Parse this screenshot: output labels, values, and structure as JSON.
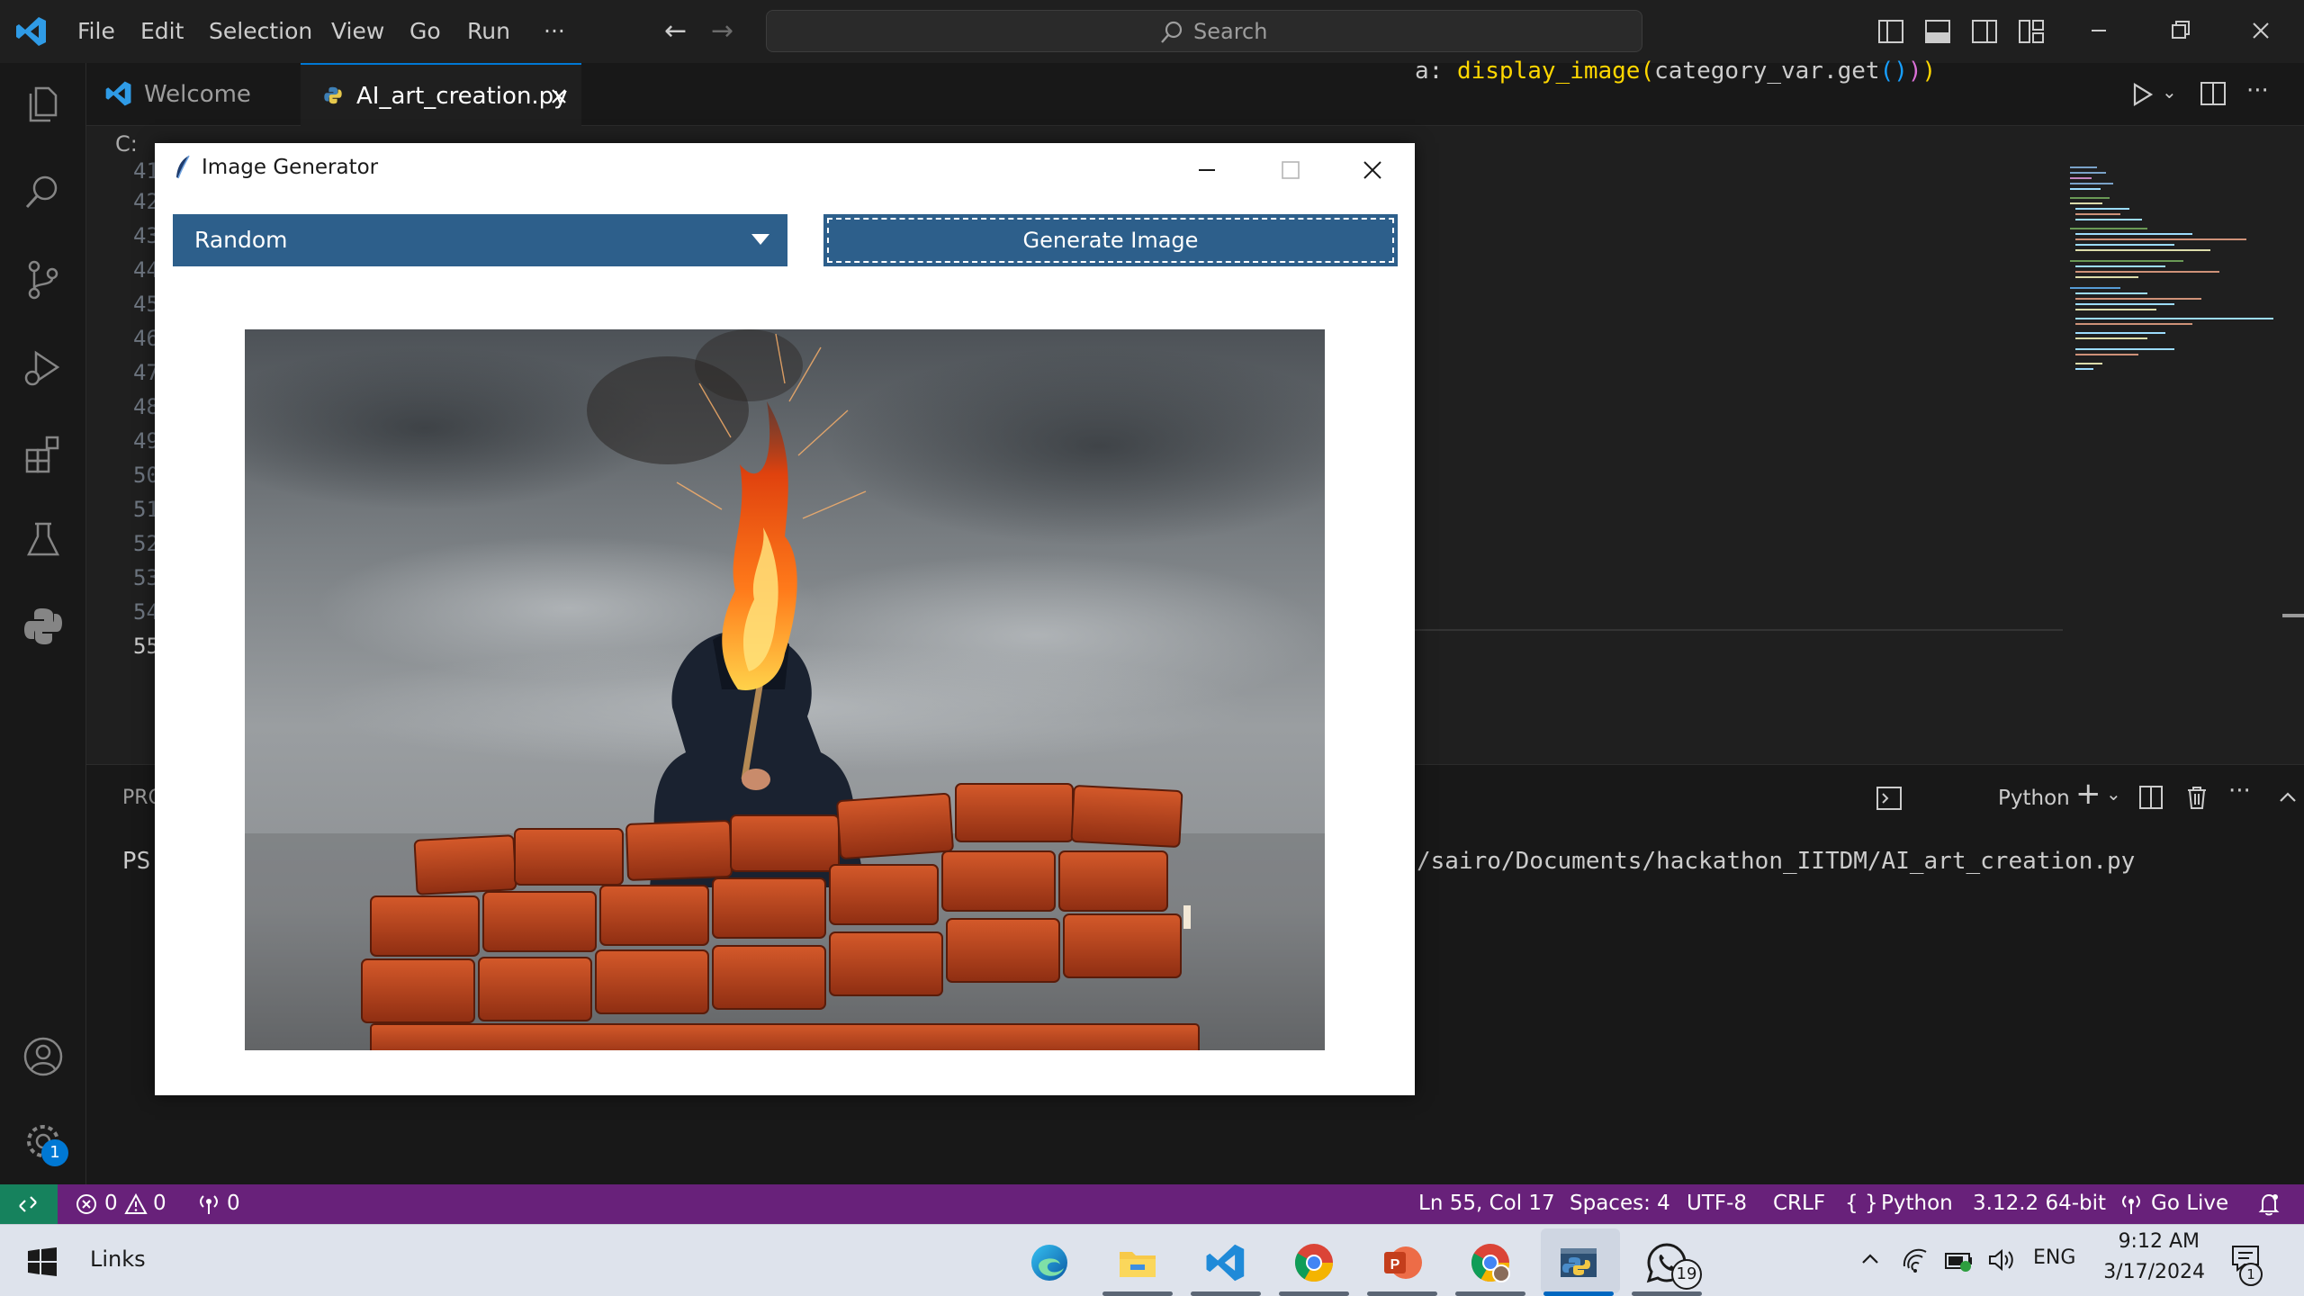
{
  "titlebar": {
    "menus": [
      "File",
      "Edit",
      "Selection",
      "View",
      "Go",
      "Run"
    ],
    "more": "···",
    "search_placeholder": "Search"
  },
  "tabs": {
    "welcome": "Welcome",
    "active_file": "AI_art_creation.py",
    "breadcrumb": "C:"
  },
  "editor": {
    "line_numbers": [
      "41",
      "42",
      "43",
      "44",
      "45",
      "46",
      "47",
      "48",
      "49",
      "50",
      "51",
      "52",
      "53",
      "54",
      "55"
    ],
    "active_line": "55",
    "code_prefix": "a: ",
    "code_call": "display_image",
    "code_arg": "category_var.get",
    "code_parens_inner": "()",
    "code_close_outer": ")",
    "code_close_paren": ")"
  },
  "panel": {
    "tab_label": "PRO",
    "terminal_name": "Python",
    "prompt": "PS",
    "terminal_path": "/sairo/Documents/hackathon_IITDM/AI_art_creation.py"
  },
  "statusbar": {
    "errors": "0",
    "warnings": "0",
    "ports": "0",
    "cursor": "Ln 55, Col 17",
    "spaces": "Spaces: 4",
    "encoding": "UTF-8",
    "eol": "CRLF",
    "language": "Python",
    "interpreter": "3.12.2 64-bit",
    "go_live": "Go Live"
  },
  "activity_badge": "1",
  "dialog": {
    "title": "Image Generator",
    "category_selected": "Random",
    "generate_label": "Generate Image",
    "image_icon": "hooded-figure-fire-brick-wall-image"
  },
  "taskbar": {
    "links": "Links",
    "lang": "ENG",
    "time": "9:12 AM",
    "date": "3/17/2024",
    "whatsapp_badge": "19",
    "notifications_badge": "1"
  },
  "colors": {
    "statusbar": "#68217a",
    "remote": "#16825d",
    "tk_button": "#2d5f8b",
    "vscode_blue": "#0078d4"
  }
}
